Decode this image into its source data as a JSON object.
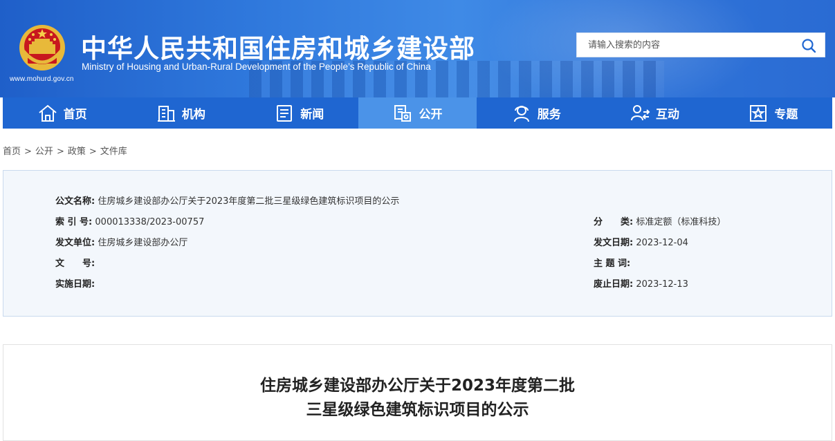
{
  "header": {
    "title_cn": "中华人民共和国住房和城乡建设部",
    "title_en": "Ministry of Housing and Urban-Rural Development of the People’s Republic of China",
    "site_url": "www.mohurd.gov.cn",
    "search_placeholder": "请输入搜索的内容",
    "colors": {
      "banner": "#2f78dc",
      "nav": "#1f66d1",
      "nav_active": "#4b93e8"
    }
  },
  "nav": {
    "items": [
      {
        "label": "首页",
        "icon": "home-icon"
      },
      {
        "label": "机构",
        "icon": "building-icon"
      },
      {
        "label": "新闻",
        "icon": "news-icon"
      },
      {
        "label": "公开",
        "icon": "disclosure-icon",
        "active": true
      },
      {
        "label": "服务",
        "icon": "service-icon"
      },
      {
        "label": "互动",
        "icon": "interaction-icon"
      },
      {
        "label": "专题",
        "icon": "topic-star-icon"
      }
    ]
  },
  "breadcrumb": {
    "items": [
      "首页",
      "公开",
      "政策",
      "文件库"
    ],
    "separator": ">"
  },
  "info": {
    "doc_name_label": "公文名称:",
    "doc_name": "住房城乡建设部办公厅关于2023年度第二批三星级绿色建筑标识项目的公示",
    "index_label": "索 引 号:",
    "index": "000013338/2023-00757",
    "category_label": "分　　类:",
    "category": "标准定额（标准科技）",
    "issuer_label": "发文单位:",
    "issuer": "住房城乡建设部办公厅",
    "issue_date_label": "发文日期:",
    "issue_date": "2023-12-04",
    "doc_no_label": "文　　号:",
    "doc_no": "",
    "subject_label": "主 题 词:",
    "subject": "",
    "effective_label": "实施日期:",
    "effective": "",
    "expire_label": "废止日期:",
    "expire": "2023-12-13"
  },
  "article": {
    "title_line1": "住房城乡建设部办公厅关于2023年度第二批",
    "title_line2": "三星级绿色建筑标识项目的公示"
  }
}
